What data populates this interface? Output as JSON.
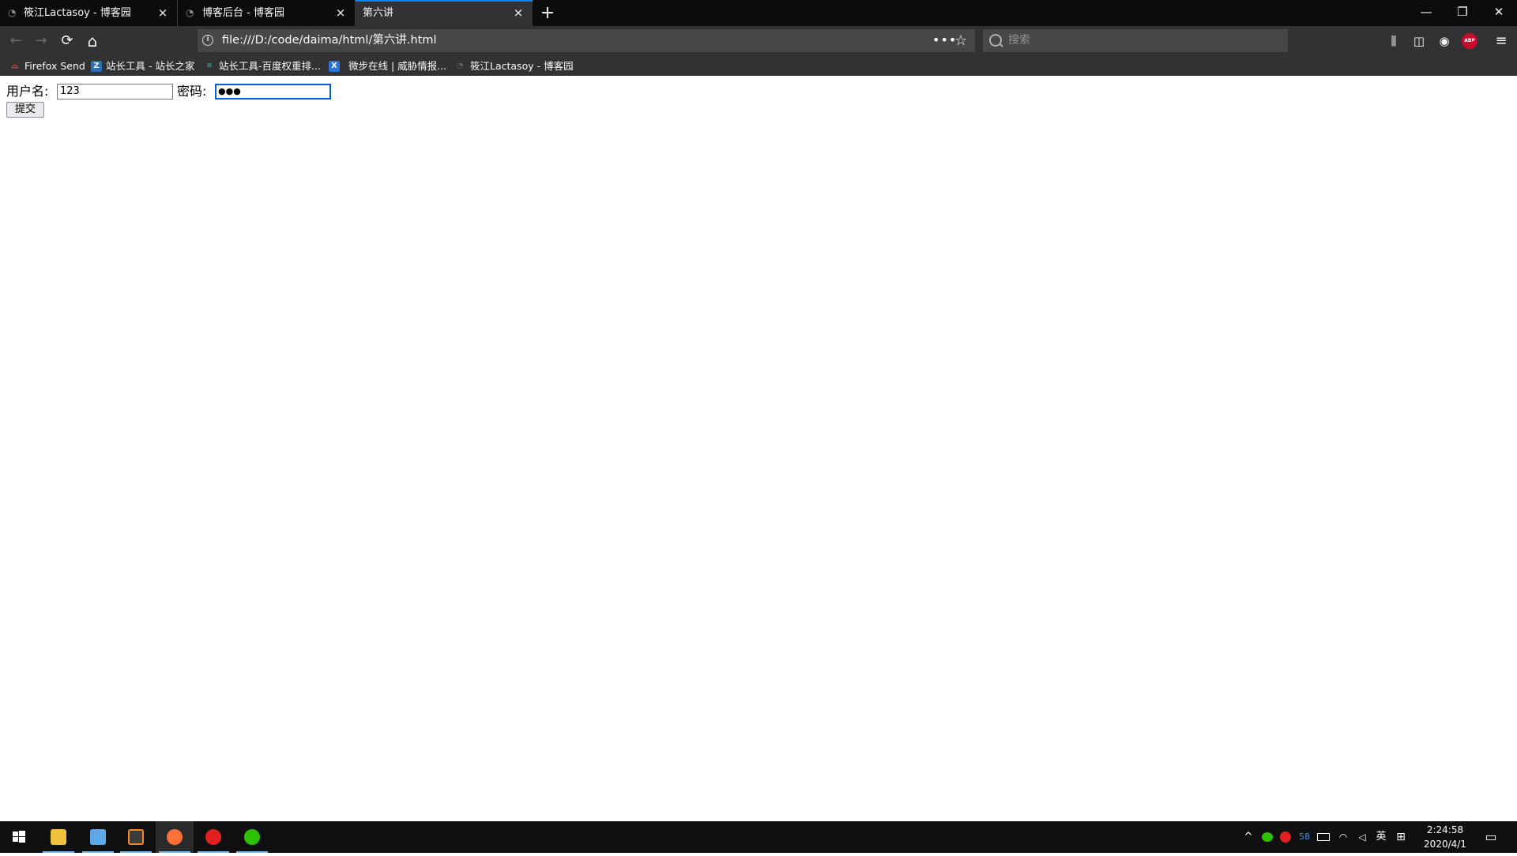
{
  "browser": {
    "tabs": [
      {
        "title": "筱江Lactasoy - 博客园",
        "icon": "cnblogs-icon"
      },
      {
        "title": "博客后台 - 博客园",
        "icon": "cnblogs-icon"
      },
      {
        "title": "第六讲",
        "active": true
      }
    ],
    "close_glyph": "×",
    "new_tab_glyph": "+",
    "window_controls": {
      "minimize": "—",
      "restore": "❐",
      "close": "✕"
    },
    "nav": {
      "back": "←",
      "forward": "→",
      "reload": "⟳",
      "home": "⌂"
    },
    "url": "file:///D:/code/daima/html/第六讲.html",
    "page_actions": "•••",
    "bookmark_star": "☆",
    "search_placeholder": "搜索",
    "toolbar_icons": {
      "library": "⫼",
      "sidebar": "◫",
      "account": "◉",
      "abp": "ABP",
      "menu": "≡"
    },
    "bookmarks": [
      {
        "label": "Firefox Send",
        "icon": "firefox-send-icon",
        "color": "#e74c3c"
      },
      {
        "label": "站长工具 - 站长之家",
        "icon": "chinaz-icon",
        "color": "#2c6fb5"
      },
      {
        "label": "站长工具-百度权重排...",
        "icon": "aizhan-icon",
        "color": "#1ba784"
      },
      {
        "label": "微步在线 | 威胁情报...",
        "icon": "threatbook-icon",
        "color": "#2b73d6"
      },
      {
        "label": "筱江Lactasoy - 博客园",
        "icon": "cnblogs-icon",
        "color": "#666666"
      }
    ]
  },
  "page": {
    "username_label": "用户名:",
    "username_value": "123",
    "password_label": "密码:",
    "password_value": "●●●",
    "submit_label": "提交"
  },
  "taskbar": {
    "start_icon": "windows-start-icon",
    "apps": [
      {
        "name": "file-explorer-icon",
        "color": "#f0c23b",
        "running": true
      },
      {
        "name": "app-icon",
        "color": "#5fa8e8",
        "running": true
      },
      {
        "name": "sublime-text-icon",
        "color": "#f28a1d",
        "running": true
      },
      {
        "name": "firefox-icon",
        "color": "#ff7139",
        "running": true,
        "active": true
      },
      {
        "name": "netease-music-icon",
        "color": "#e1211f",
        "running": true
      },
      {
        "name": "wechat-icon",
        "color": "#2dc100",
        "running": true
      }
    ],
    "tray": {
      "chevron": "^",
      "badge_number": "58",
      "ime": "英",
      "ime_mode": "⊞"
    },
    "time": "2:24:58",
    "date": "2020/4/1"
  },
  "colors": {
    "chrome_dark": "#0c0c0d",
    "toolbar": "#323234",
    "active_tab_accent": "#0a84ff",
    "taskbar": "#101010",
    "focus_ring": "#0060df"
  }
}
